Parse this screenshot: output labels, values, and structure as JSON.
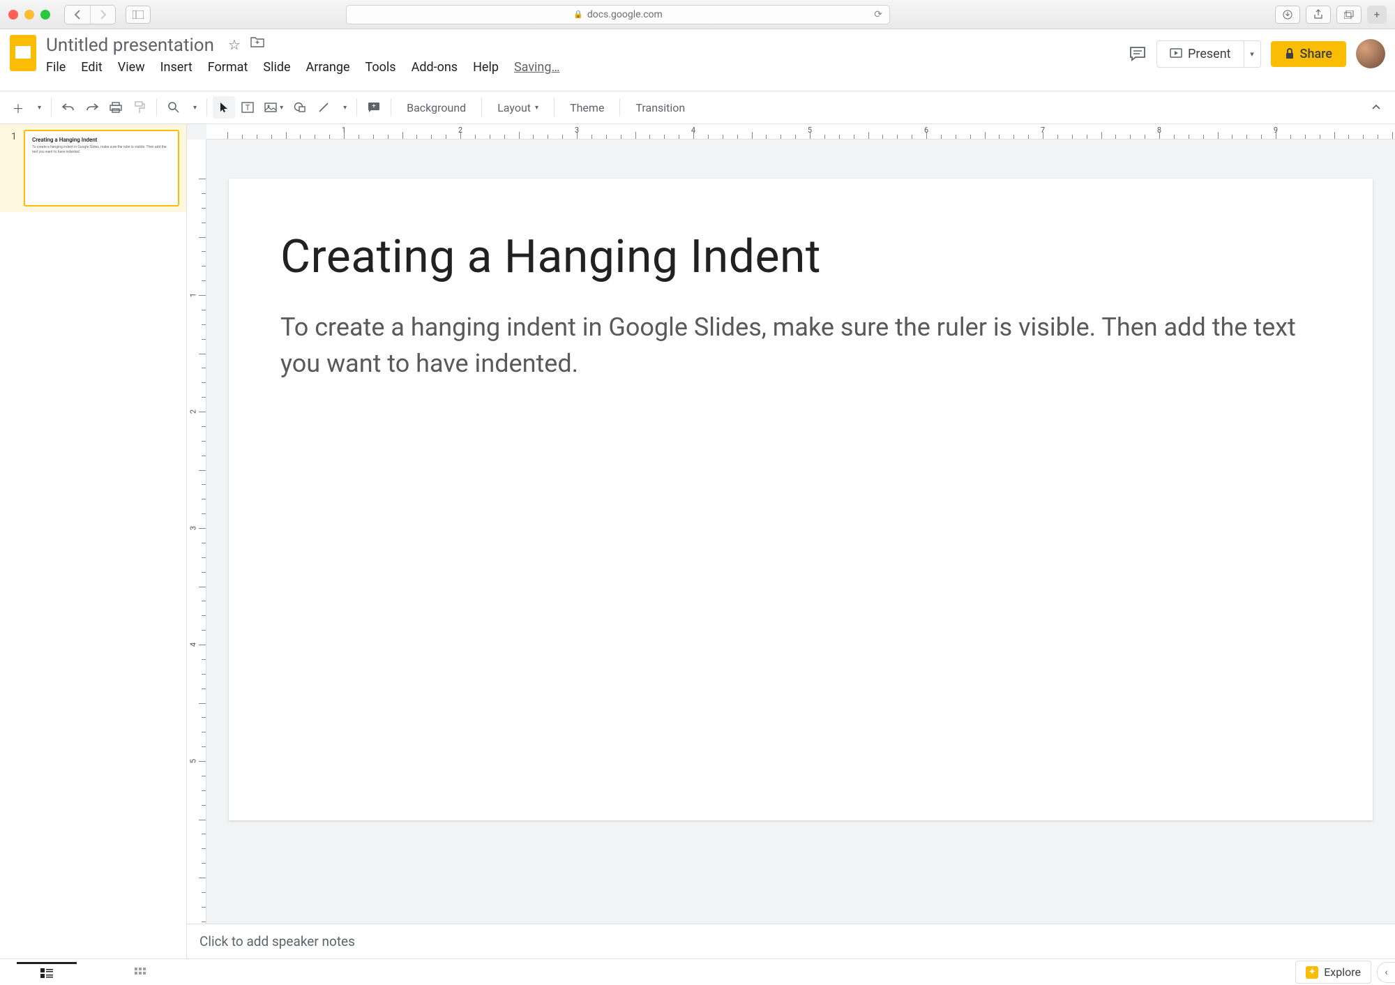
{
  "browser": {
    "url": "docs.google.com"
  },
  "doc": {
    "title": "Untitled presentation",
    "saving": "Saving…"
  },
  "menubar": [
    "File",
    "Edit",
    "View",
    "Insert",
    "Format",
    "Slide",
    "Arrange",
    "Tools",
    "Add-ons",
    "Help"
  ],
  "header_buttons": {
    "present": "Present",
    "share": "Share"
  },
  "toolbar_labels": {
    "background": "Background",
    "layout": "Layout",
    "theme": "Theme",
    "transition": "Transition"
  },
  "ruler_h": [
    "1",
    "2",
    "3",
    "4",
    "5",
    "6",
    "7",
    "8",
    "9"
  ],
  "ruler_v": [
    "1",
    "2",
    "3",
    "4",
    "5"
  ],
  "slide": {
    "number": "1",
    "title": "Creating a Hanging Indent",
    "body": "To create a hanging indent in Google Slides, make sure the ruler is visible. Then add the text you want to have indented."
  },
  "notes_placeholder": "Click to add speaker notes",
  "explore": "Explore"
}
